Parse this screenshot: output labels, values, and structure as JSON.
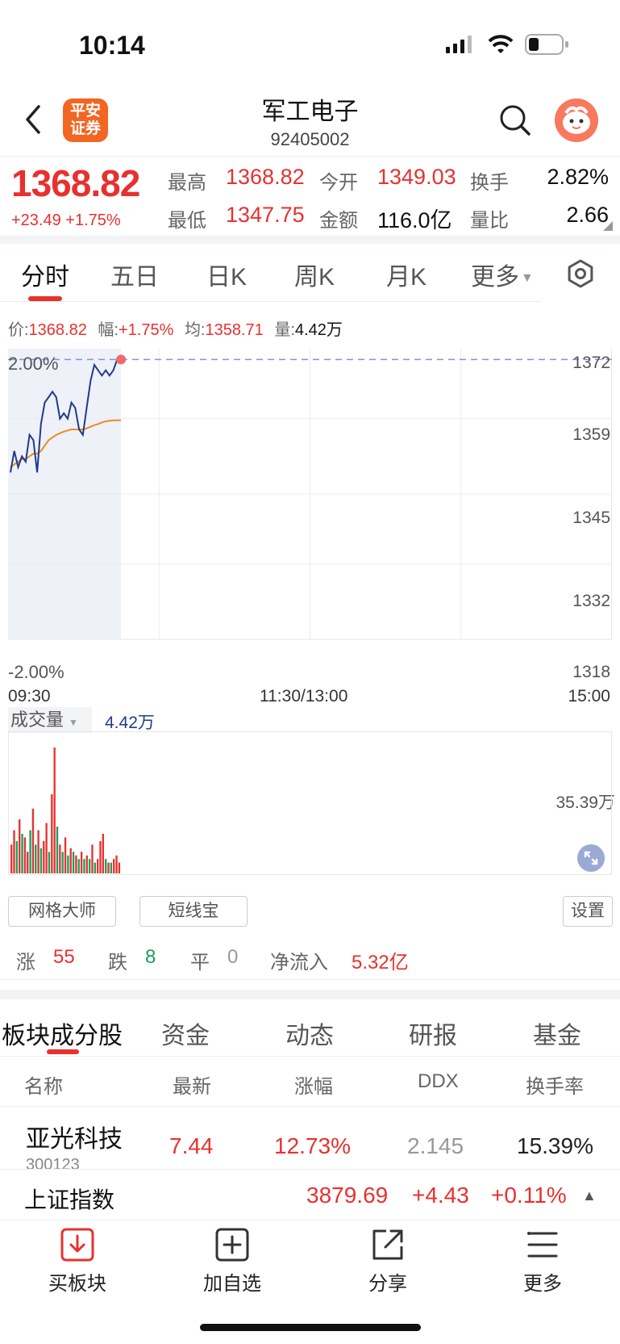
{
  "status_bar": {
    "time": "10:14"
  },
  "header": {
    "title": "军工电子",
    "code": "92405002",
    "logo_text": "平安证券"
  },
  "quote": {
    "price": "1368.82",
    "change": "+23.49",
    "change_pct": "+1.75%",
    "high_label": "最高",
    "high": "1368.82",
    "open_label": "今开",
    "open": "1349.03",
    "turnover_label": "换手",
    "turnover": "2.82%",
    "low_label": "最低",
    "low": "1347.75",
    "amount_label": "金额",
    "amount": "116.0亿",
    "vol_ratio_label": "量比",
    "vol_ratio": "2.66"
  },
  "chart_tabs": [
    "分时",
    "五日",
    "日K",
    "周K",
    "月K",
    "更多"
  ],
  "info_line": {
    "price_label": "价:",
    "price": "1368.82",
    "amp_label": "幅:",
    "amp": "+1.75%",
    "avg_label": "均:",
    "avg": "1358.71",
    "vol_label": "量:",
    "vol": "4.42万"
  },
  "chart_data": {
    "type": "line",
    "y_pct_top": "2.00%",
    "y_pct_bottom": "-2.00%",
    "y_ticks": [
      "1372",
      "1359",
      "1345",
      "1332",
      "1318"
    ],
    "ylim": [
      1318,
      1372
    ],
    "x_ticks": [
      "09:30",
      "11:30/13:00",
      "15:00"
    ],
    "series": [
      {
        "values": [
          1349,
          1353,
          1350,
          1352,
          1351,
          1356,
          1355,
          1349,
          1358,
          1362,
          1363,
          1364,
          1363,
          1359,
          1360,
          1359,
          1362,
          1361,
          1357,
          1356,
          1361,
          1366,
          1369,
          1368,
          1367,
          1368,
          1367,
          1368,
          1370,
          1370
        ]
      },
      {
        "values": [
          1350,
          1350.5,
          1351,
          1351.5,
          1351.5,
          1352,
          1352.5,
          1352.5,
          1353,
          1354,
          1355,
          1355.5,
          1356,
          1356.3,
          1356.6,
          1356.8,
          1357,
          1357,
          1357,
          1357,
          1357.2,
          1357.5,
          1357.8,
          1358,
          1358.3,
          1358.5,
          1358.6,
          1358.7,
          1358.7,
          1358.71
        ]
      }
    ],
    "volume": {
      "label": "成交量",
      "value": "4.42万",
      "max_label": "35.39万",
      "bars": [
        8,
        12,
        -9,
        15,
        -11,
        10,
        6,
        -12,
        18,
        -8,
        12,
        -7,
        9,
        14,
        -6,
        22,
        35,
        -13,
        8,
        -6,
        10,
        -5,
        7,
        -6,
        5,
        -4,
        6,
        -4,
        5,
        -4,
        8,
        -3,
        4,
        9,
        11,
        -4,
        3,
        -3,
        4,
        5,
        3
      ]
    }
  },
  "tools": {
    "grid": "网格大师",
    "short": "短线宝",
    "settings": "设置"
  },
  "stats": {
    "up_label": "涨",
    "up": "55",
    "down_label": "跌",
    "down": "8",
    "flat_label": "平",
    "flat": "0",
    "inflow_label": "净流入",
    "inflow": "5.32亿"
  },
  "sub_tabs": [
    "板块成分股",
    "资金",
    "动态",
    "研报",
    "基金"
  ],
  "table": {
    "headers": [
      "名称",
      "最新",
      "涨幅",
      "DDX",
      "换手率"
    ],
    "rows": [
      {
        "name": "亚光科技",
        "code": "300123",
        "latest": "7.44",
        "change": "12.73%",
        "ddx": "2.145",
        "turnover": "15.39%"
      }
    ]
  },
  "index_bar": {
    "name": "上证指数",
    "value": "3879.69",
    "change": "+4.43",
    "pct": "+0.11%"
  },
  "bottom_nav": [
    {
      "label": "买板块",
      "icon": "download-icon"
    },
    {
      "label": "加自选",
      "icon": "add-icon"
    },
    {
      "label": "分享",
      "icon": "share-icon"
    },
    {
      "label": "更多",
      "icon": "menu-icon"
    }
  ],
  "colors": {
    "up": "#e8312f",
    "down": "#17a05d",
    "price_line": "#1f3b8c",
    "avg_line": "#f08a1c"
  }
}
